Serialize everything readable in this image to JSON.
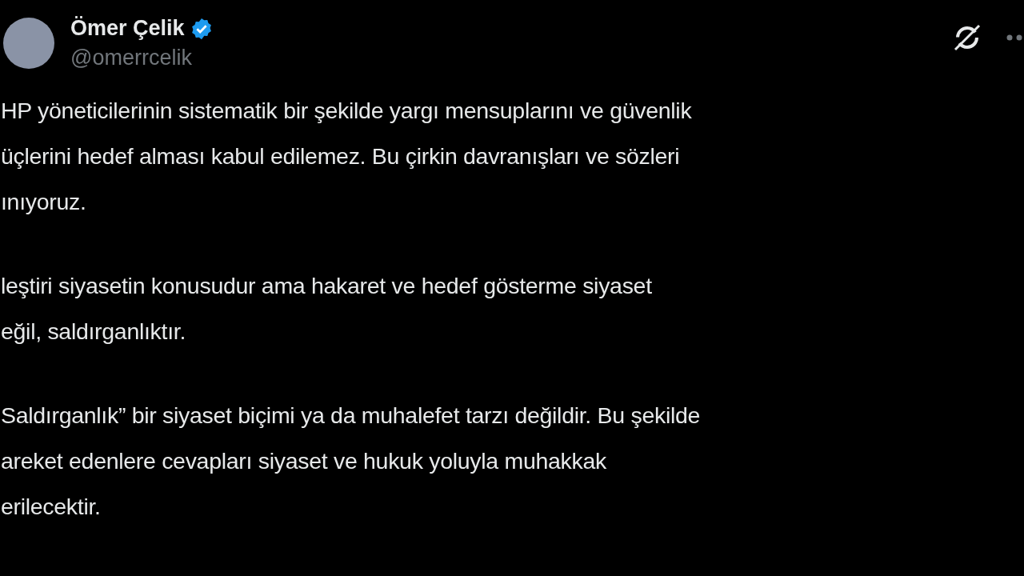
{
  "author": {
    "name": "Ömer Çelik",
    "verified": true,
    "handle": "@omerrcelik"
  },
  "paragraphs": [
    {
      "lines": [
        "HP yöneticilerinin sistematik bir şekilde yargı mensuplarını ve güvenlik",
        "üçlerini hedef alması kabul edilemez. Bu çirkin davranışları ve sözleri",
        "ınıyoruz."
      ]
    },
    {
      "lines": [
        "leştiri siyasetin konusudur ama hakaret ve hedef gösterme siyaset",
        "eğil, saldırganlıktır."
      ]
    },
    {
      "lines": [
        "Saldırganlık” bir siyaset biçimi ya da muhalefet tarzı değildir. Bu şekilde",
        "areket edenlere cevapları siyaset ve hukuk yoluyla muhakkak",
        "erilecektir."
      ]
    }
  ]
}
